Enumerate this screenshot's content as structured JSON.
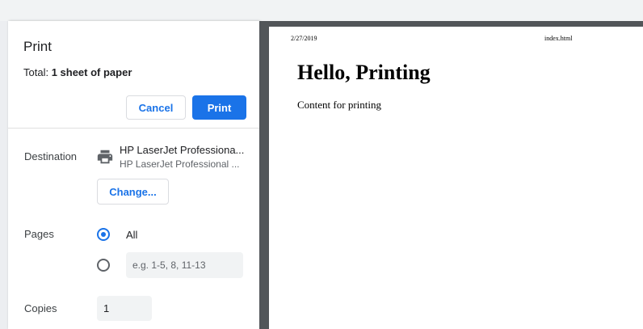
{
  "dialog": {
    "title": "Print",
    "total_prefix": "Total: ",
    "total_value": "1 sheet of paper",
    "cancel_label": "Cancel",
    "print_label": "Print"
  },
  "destination": {
    "label": "Destination",
    "icon": "printer-icon",
    "name": "HP LaserJet Professiona...",
    "sub": "HP LaserJet Professional ...",
    "change_label": "Change..."
  },
  "pages": {
    "label": "Pages",
    "all_label": "All",
    "all_selected": true,
    "range_placeholder": "e.g. 1-5, 8, 11-13"
  },
  "copies": {
    "label": "Copies",
    "value": "1"
  },
  "preview": {
    "date": "2/27/2019",
    "filename": "index.html",
    "heading": "Hello, Printing",
    "body": "Content for printing"
  },
  "colors": {
    "accent": "#1a73e8",
    "preview_background": "#525659"
  }
}
